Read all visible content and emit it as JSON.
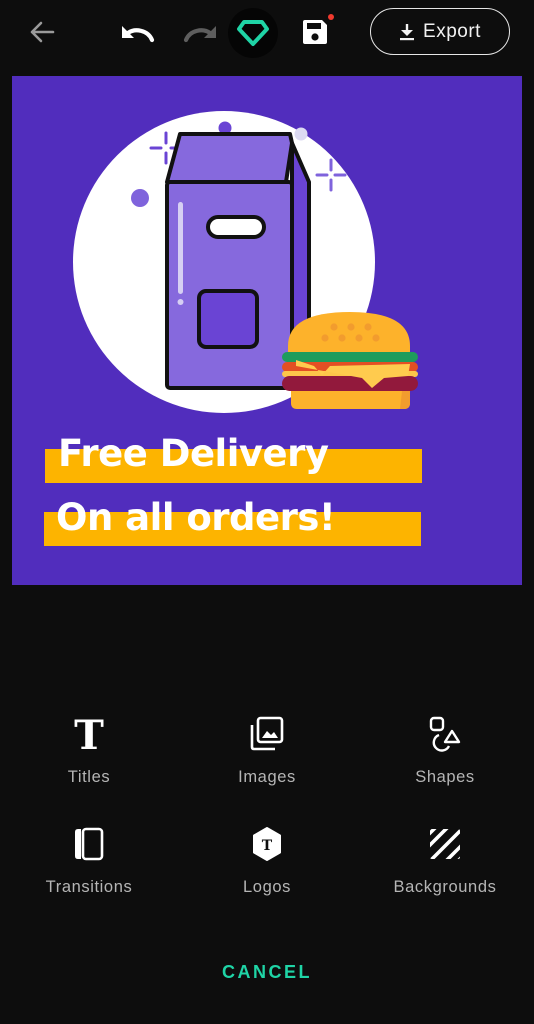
{
  "topbar": {
    "back_icon": "arrow-left-icon",
    "undo_icon": "undo-icon",
    "redo_icon": "redo-icon",
    "premium_icon": "diamond-icon",
    "save_icon": "floppy-disk-icon",
    "save_unsaved_indicator": true,
    "export_label": "Export",
    "export_icon": "download-icon",
    "accent_color": "#1fd4a6",
    "indicator_color": "#f03a2e"
  },
  "canvas": {
    "background_color": "#512dbd",
    "headline_line1": "Free Delivery",
    "headline_line2": "On all orders!",
    "highlight_color": "#fdb400",
    "illustration": "delivery-bag-with-burger"
  },
  "tools": [
    {
      "label": "Titles",
      "icon": "text-t-icon"
    },
    {
      "label": "Images",
      "icon": "images-stack-icon"
    },
    {
      "label": "Shapes",
      "icon": "shapes-icon"
    },
    {
      "label": "Transitions",
      "icon": "transitions-icon"
    },
    {
      "label": "Logos",
      "icon": "logo-hexagon-icon"
    },
    {
      "label": "Backgrounds",
      "icon": "backgrounds-stripes-icon"
    }
  ],
  "cancel_label": "CANCEL"
}
